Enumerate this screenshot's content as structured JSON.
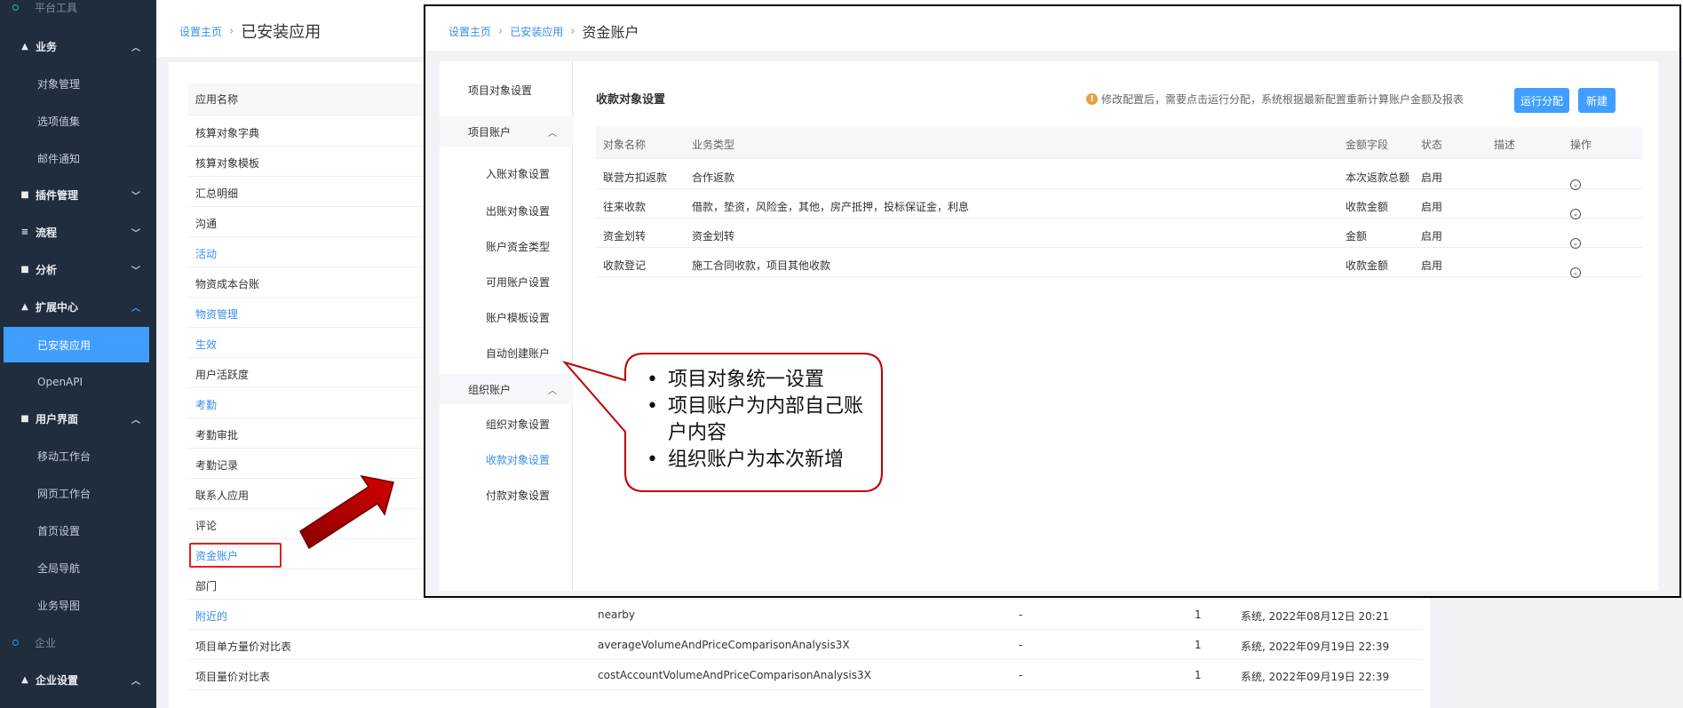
{
  "sidebar": {
    "sections": [
      {
        "label": "平台工具"
      },
      {
        "label": "企业"
      }
    ],
    "groups": [
      {
        "label": "业务",
        "icon": "briefcase-icon"
      },
      {
        "label": "插件管理",
        "icon": "grid-icon"
      },
      {
        "label": "流程",
        "icon": "flow-icon"
      },
      {
        "label": "分析",
        "icon": "chart-icon"
      },
      {
        "label": "扩展中心",
        "icon": "rocket-icon"
      },
      {
        "label": "用户界面",
        "icon": "grid-icon"
      },
      {
        "label": "企业设置",
        "icon": "building-icon"
      }
    ],
    "items": [
      {
        "label": "对象管理"
      },
      {
        "label": "选项值集"
      },
      {
        "label": "邮件通知"
      },
      {
        "label": "已安装应用"
      },
      {
        "label": "OpenAPI"
      },
      {
        "label": "移动工作台"
      },
      {
        "label": "网页工作台"
      },
      {
        "label": "首页设置"
      },
      {
        "label": "全局导航"
      },
      {
        "label": "业务导图"
      }
    ]
  },
  "background": {
    "breadcrumb": {
      "home": "设置主页",
      "current": "已安装应用"
    },
    "table_header": "应用名称",
    "rows": [
      {
        "name": "核算对象字典",
        "link": false
      },
      {
        "name": "核算对象模板",
        "link": false
      },
      {
        "name": "汇总明细",
        "link": false
      },
      {
        "name": "沟通",
        "link": false
      },
      {
        "name": "活动",
        "link": true
      },
      {
        "name": "物资成本台账",
        "link": false
      },
      {
        "name": "物资管理",
        "link": true
      },
      {
        "name": "生效",
        "link": true
      },
      {
        "name": "用户活跃度",
        "link": false
      },
      {
        "name": "考勤",
        "link": true
      },
      {
        "name": "考勤审批",
        "link": false
      },
      {
        "name": "考勤记录",
        "link": false
      },
      {
        "name": "联系人应用",
        "link": false
      },
      {
        "name": "评论",
        "link": false
      },
      {
        "name": "资金账户",
        "link": true
      },
      {
        "name": "部门",
        "link": false
      },
      {
        "name": "附近的",
        "link": true,
        "code": "nearby",
        "dash": "-",
        "version": "1",
        "updated": "系统, 2022年08月12日 20:21"
      },
      {
        "name": "项目单方量价对比表",
        "link": false,
        "code": "averageVolumeAndPriceComparisonAnalysis3X",
        "dash": "-",
        "version": "1",
        "updated": "系统, 2022年09月19日 22:39"
      },
      {
        "name": "项目量价对比表",
        "link": false,
        "code": "costAccountVolumeAndPriceComparisonAnalysis3X",
        "dash": "-",
        "version": "1",
        "updated": "系统, 2022年09月19日 22:39"
      }
    ]
  },
  "overlay": {
    "breadcrumb": {
      "home": "设置主页",
      "middle": "已安装应用",
      "current": "资金账户"
    },
    "nav": [
      {
        "label": "项目对象设置",
        "kind": "top"
      },
      {
        "label": "项目账户",
        "kind": "group"
      },
      {
        "label": "入账对象设置",
        "kind": "sub"
      },
      {
        "label": "出账对象设置",
        "kind": "sub"
      },
      {
        "label": "账户资金类型",
        "kind": "sub"
      },
      {
        "label": "可用账户设置",
        "kind": "sub"
      },
      {
        "label": "账户模板设置",
        "kind": "sub"
      },
      {
        "label": "自动创建账户",
        "kind": "sub"
      },
      {
        "label": "组织账户",
        "kind": "group"
      },
      {
        "label": "组织对象设置",
        "kind": "sub"
      },
      {
        "label": "收款对象设置",
        "kind": "sub",
        "selected": true
      },
      {
        "label": "付款对象设置",
        "kind": "sub"
      }
    ],
    "panel_title": "收款对象设置",
    "notice": "修改配置后，需要点击运行分配，系统根据最新配置重新计算账户金额及报表",
    "buttons": {
      "run": "运行分配",
      "new": "新建"
    },
    "columns": [
      "对象名称",
      "业务类型",
      "金额字段",
      "状态",
      "描述",
      "操作"
    ],
    "rows": [
      {
        "name": "联营方扣返款",
        "type": "合作返款",
        "field": "本次返款总额",
        "state": "启用",
        "desc": ""
      },
      {
        "name": "往来收款",
        "type": "借款，垫资，风险金，其他，房产抵押，投标保证金，利息",
        "field": "收款金额",
        "state": "启用",
        "desc": ""
      },
      {
        "name": "资金划转",
        "type": "资金划转",
        "field": "金额",
        "state": "启用",
        "desc": ""
      },
      {
        "name": "收款登记",
        "type": "施工合同收款，项目其他收款",
        "field": "收款金额",
        "state": "启用",
        "desc": ""
      }
    ]
  },
  "annotation": {
    "bullets": [
      "项目对象统一设置",
      "项目账户为内部自己账户内容",
      "组织账户为本次新增"
    ]
  },
  "colors": {
    "accent": "#409eff",
    "sidebar": "#1f2d3d",
    "highlight": "#e02020",
    "arrow": "#c00000"
  }
}
